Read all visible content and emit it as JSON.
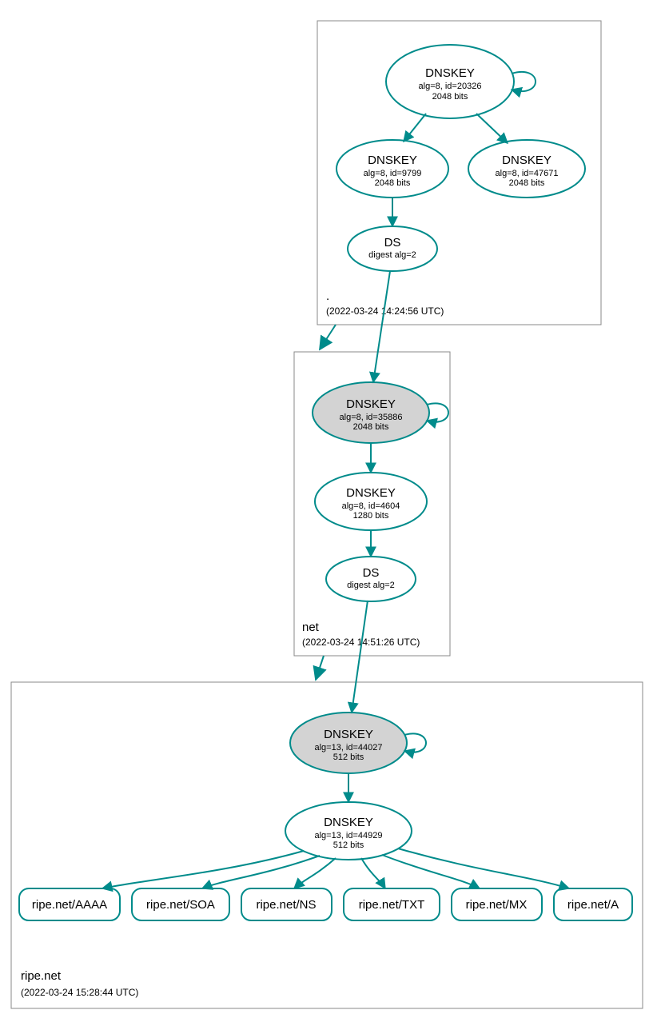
{
  "colors": {
    "stroke": "#008B8B",
    "filled": "#d3d3d3"
  },
  "zones": {
    "root": {
      "label": ".",
      "timestamp": "(2022-03-24 14:24:56 UTC)"
    },
    "net": {
      "label": "net",
      "timestamp": "(2022-03-24 14:51:26 UTC)"
    },
    "ripe": {
      "label": "ripe.net",
      "timestamp": "(2022-03-24 15:28:44 UTC)"
    }
  },
  "nodes": {
    "root_ksk": {
      "title": "DNSKEY",
      "l1": "alg=8, id=20326",
      "l2": "2048 bits"
    },
    "root_zsk1": {
      "title": "DNSKEY",
      "l1": "alg=8, id=9799",
      "l2": "2048 bits"
    },
    "root_zsk2": {
      "title": "DNSKEY",
      "l1": "alg=8, id=47671",
      "l2": "2048 bits"
    },
    "root_ds": {
      "title": "DS",
      "l1": "digest alg=2"
    },
    "net_ksk": {
      "title": "DNSKEY",
      "l1": "alg=8, id=35886",
      "l2": "2048 bits"
    },
    "net_zsk": {
      "title": "DNSKEY",
      "l1": "alg=8, id=4604",
      "l2": "1280 bits"
    },
    "net_ds": {
      "title": "DS",
      "l1": "digest alg=2"
    },
    "ripe_ksk": {
      "title": "DNSKEY",
      "l1": "alg=13, id=44027",
      "l2": "512 bits"
    },
    "ripe_zsk": {
      "title": "DNSKEY",
      "l1": "alg=13, id=44929",
      "l2": "512 bits"
    }
  },
  "rr": {
    "aaaa": "ripe.net/AAAA",
    "soa": "ripe.net/SOA",
    "ns": "ripe.net/NS",
    "txt": "ripe.net/TXT",
    "mx": "ripe.net/MX",
    "a": "ripe.net/A"
  }
}
